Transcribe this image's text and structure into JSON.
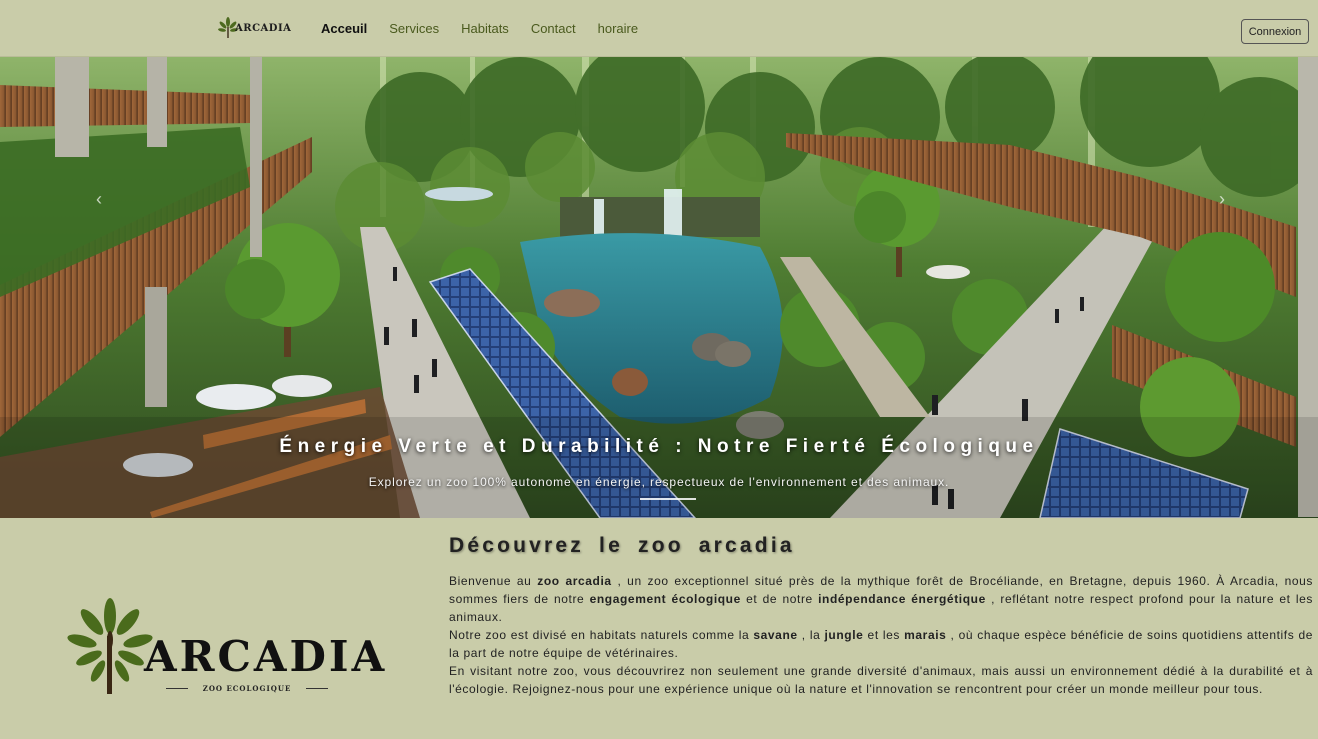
{
  "nav": {
    "logo_text": "ARCADIA",
    "links": [
      "Acceuil",
      "Services",
      "Habitats",
      "Contact",
      "horaire"
    ],
    "active_index": 0,
    "login_label": "Connexion"
  },
  "hero": {
    "title": "Énergie Verte et Durabilité : Notre Fierté Écologique",
    "subtitle": "Explorez un zoo 100% autonome en énergie, respectueux de l'environnement et des animaux."
  },
  "logo": {
    "brand": "ARCADIA",
    "tagline": "ZOO ECOLOGIQUE"
  },
  "about": {
    "title": "Découvrez le zoo arcadia",
    "p1": {
      "a": "Bienvenue au ",
      "b": "zoo arcadia",
      "c": " , un zoo exceptionnel situé près de la mythique forêt de Brocéliande, en Bretagne, depuis 1960. À Arcadia, nous sommes fiers de notre ",
      "d": "engagement écologique",
      "e": " et de notre ",
      "f": "indépendance énergétique",
      "g": " , reflétant notre respect profond pour la nature et les animaux."
    },
    "p2": {
      "a": "Notre zoo est divisé en habitats naturels comme la ",
      "b": "savane",
      "c": " , la ",
      "d": "jungle",
      "e": " et les ",
      "f": "marais",
      "g": " , où chaque espèce bénéficie de soins quotidiens attentifs de la part de notre équipe de vétérinaires."
    },
    "p3": "En visitant notre zoo, vous découvrirez non seulement une grande diversité d'animaux, mais aussi un environnement dédié à la durabilité et à l'écologie. Rejoignez-nous pour une expérience unique où la nature et l'innovation se rencontrent pour créer un monde meilleur pour tous."
  },
  "colors": {
    "background": "#c9cca9",
    "nav_link": "#4a5a1e",
    "text": "#222222"
  }
}
